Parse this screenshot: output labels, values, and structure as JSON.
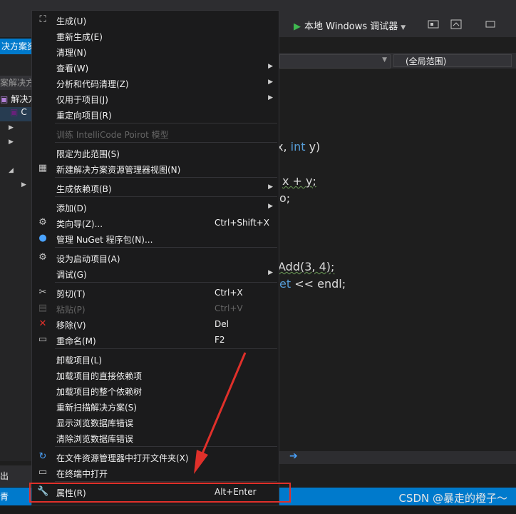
{
  "toolbar": {
    "run_label": "本地 Windows 调试器",
    "play_icon": "play-icon"
  },
  "solution_explorer": {
    "header": "决方案资",
    "search": "案解决方",
    "rows": [
      "解决方",
      "C",
      "",
      "",
      "",
      "",
      "",
      ""
    ]
  },
  "editor": {
    "scope_dropdown": "(全局范围)",
    "signature": {
      "text1": "x, ",
      "kw": "int",
      "text2": " y)"
    },
    "line_return": "x + y;",
    "line_semicolon": "o;",
    "line_call": "Add(3, 4);",
    "line_cout": {
      "kw": "et",
      "rest": " << endl;"
    }
  },
  "context_menu": {
    "items": [
      {
        "label": "生成(U)",
        "icon": "build-icon"
      },
      {
        "label": "重新生成(E)"
      },
      {
        "label": "清理(N)"
      },
      {
        "label": "查看(W)",
        "submenu": true
      },
      {
        "label": "分析和代码清理(Z)",
        "submenu": true
      },
      {
        "label": "仅用于项目(J)",
        "submenu": true
      },
      {
        "label": "重定向项目(R)"
      },
      {
        "label": "训练 IntelliCode Poirot 模型",
        "disabled": true
      },
      {
        "label": "限定为此范围(S)"
      },
      {
        "label": "新建解决方案资源管理器视图(N)",
        "icon": "new-view-icon"
      },
      {
        "label": "生成依赖项(B)",
        "submenu": true
      },
      {
        "label": "添加(D)",
        "submenu": true
      },
      {
        "label": "类向导(Z)...",
        "shortcut": "Ctrl+Shift+X",
        "icon": "class-wizard-icon"
      },
      {
        "label": "管理 NuGet 程序包(N)...",
        "icon": "nuget-icon"
      },
      {
        "label": "设为启动项目(A)",
        "icon": "gear-icon"
      },
      {
        "label": "调试(G)",
        "submenu": true
      },
      {
        "label": "剪切(T)",
        "shortcut": "Ctrl+X",
        "icon": "scissors-icon"
      },
      {
        "label": "粘贴(P)",
        "shortcut": "Ctrl+V",
        "disabled": true,
        "icon": "paste-icon"
      },
      {
        "label": "移除(V)",
        "shortcut": "Del",
        "icon": "remove-icon"
      },
      {
        "label": "重命名(M)",
        "shortcut": "F2",
        "icon": "rename-icon"
      },
      {
        "label": "卸载项目(L)"
      },
      {
        "label": "加载项目的直接依赖项"
      },
      {
        "label": "加载项目的整个依赖树"
      },
      {
        "label": "重新扫描解决方案(S)"
      },
      {
        "label": "显示浏览数据库错误"
      },
      {
        "label": "清除浏览数据库错误"
      },
      {
        "label": "在文件资源管理器中打开文件夹(X)",
        "icon": "open-folder-icon"
      },
      {
        "label": "在终端中打开",
        "icon": "terminal-icon"
      },
      {
        "label": "属性(R)",
        "shortcut": "Alt+Enter",
        "icon": "wrench-icon"
      }
    ]
  },
  "output_tab": "出",
  "status_left": "青",
  "watermark": "CSDN @暴走的橙子～",
  "colors": {
    "accent": "#007acc",
    "highlight_box": "#e0302a",
    "menu_bg": "#1b1b1c",
    "keyword": "#569cd6"
  }
}
